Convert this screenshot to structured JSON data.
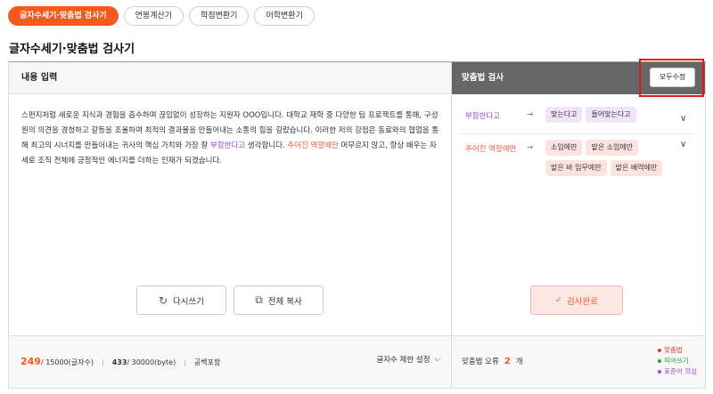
{
  "tabs": [
    "글자수세기·맞춤법 검사기",
    "연봉계산기",
    "학점변환기",
    "어학변환기"
  ],
  "page_title": "글자수세기·맞춤법 검사기",
  "left": {
    "header": "내용 입력",
    "text_parts": [
      "스펀지처럼 새로운 지식과 경험을 흡수하며 끊임없이 성장하는 지원자 OOO입니다. 대학교 재학 중 다양한 팀 프로젝트를 통해, 구성원의 의견을 경청하고 갈등을 조율하여 최적의 결과물을 만들어내는 소통의 힘을 길렀습니다. 이러한 저의 강점은 동료와의 협업을 통해 최고의 시너지를 만들어내는 귀사의 핵심 가치와 가장 잘 ",
      "부합한다고",
      " 생각합니다. ",
      "주어진 역할에만",
      " 머무르지 않고, 항상 배우는 자세로 조직 전체에 긍정적인 에너지를 더하는 인재가 되겠습니다."
    ],
    "reset_label": "다시쓰기",
    "copy_label": "전체 복사",
    "char_count": "249",
    "char_total": "/ 15000(글자수)",
    "byte_count": "433",
    "byte_total": "/ 30000(byte)",
    "space_mode": "공백포함",
    "limit_label": "글자수 제한 설정"
  },
  "right": {
    "header": "맞춤법 검사",
    "reset_all_label": "모두수정",
    "corrections": [
      {
        "original": "부합한다고",
        "suggestions": [
          "맞는다고",
          "들어맞는다고"
        ]
      },
      {
        "original": "주어진 역할에만",
        "suggestions": [
          "소임에만",
          "맡은 소임에만",
          "맡은 바 임무에만",
          "맡은 배역에만"
        ]
      }
    ],
    "done_label": "검사완료",
    "error_label": "맞춤법 오류",
    "error_count": "2",
    "error_unit": "개",
    "legend": [
      {
        "label": "맞춤법",
        "color": "#e53935"
      },
      {
        "label": "띄어쓰기",
        "color": "#2e9e3e"
      },
      {
        "label": "표준어 의심",
        "color": "#9a4dc9"
      }
    ]
  }
}
